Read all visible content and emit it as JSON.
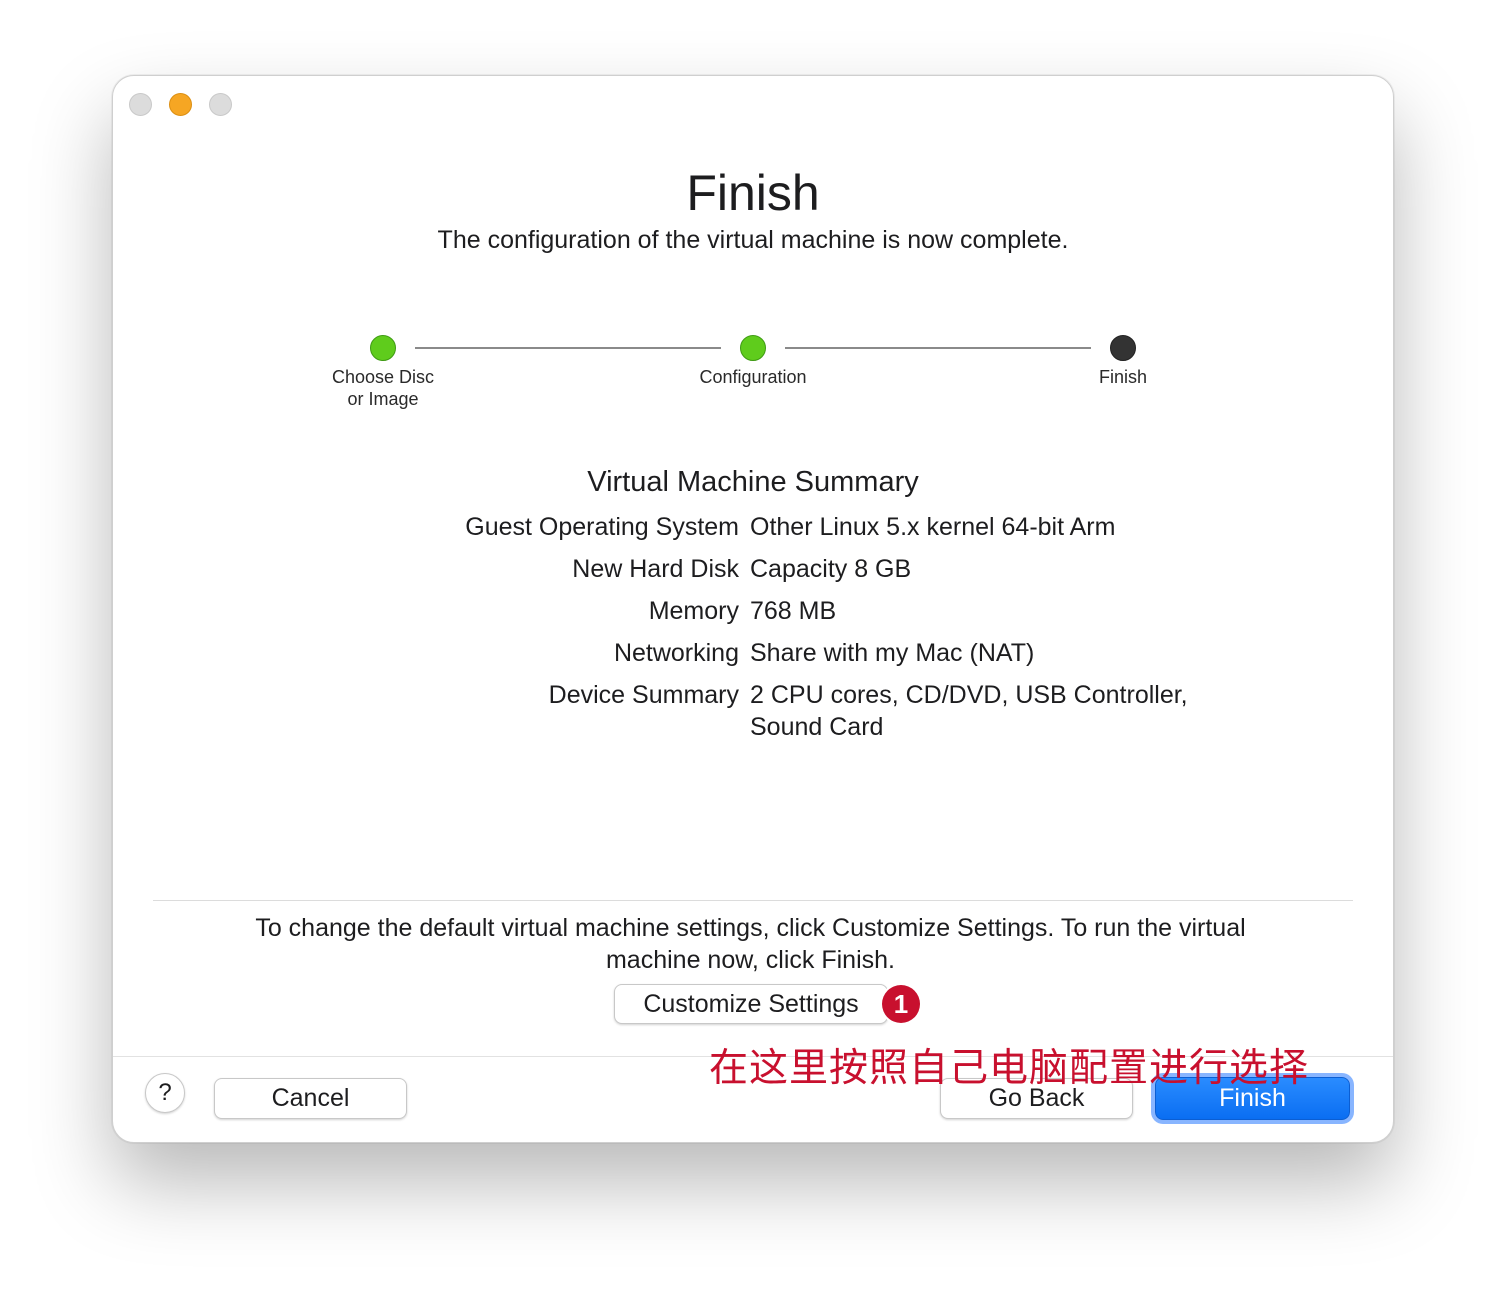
{
  "window": {
    "title": "Finish",
    "subtitle": "The configuration of the virtual machine is now complete."
  },
  "steps": [
    {
      "label": "Choose Disc\nor Image",
      "state": "done"
    },
    {
      "label": "Configuration",
      "state": "done"
    },
    {
      "label": "Finish",
      "state": "current"
    }
  ],
  "summary": {
    "heading": "Virtual Machine Summary",
    "rows": [
      {
        "key": "Guest Operating System",
        "value": "Other Linux 5.x kernel 64-bit Arm"
      },
      {
        "key": "New Hard Disk",
        "value": "Capacity 8 GB"
      },
      {
        "key": "Memory",
        "value": "768 MB"
      },
      {
        "key": "Networking",
        "value": "Share with my Mac (NAT)"
      },
      {
        "key": "Device Summary",
        "value": "2 CPU cores, CD/DVD, USB Controller, Sound Card"
      }
    ]
  },
  "info_text": "To change the default virtual machine settings, click Customize Settings. To run the virtual machine now, click Finish.",
  "buttons": {
    "customize": "Customize Settings",
    "help": "?",
    "cancel": "Cancel",
    "go_back": "Go Back",
    "finish": "Finish"
  },
  "annotation": {
    "badge": "1",
    "text": "在这里按照自己电脑配置进行选择"
  },
  "colors": {
    "step_done": "#5fcc1c",
    "step_current": "#333333",
    "primary_button": "#0a6ef2",
    "annotation": "#c8102e",
    "traffic_minimize": "#f6a623"
  },
  "icons": {
    "close": "close-icon",
    "minimize": "minimize-icon",
    "zoom": "zoom-icon",
    "help": "question-icon"
  }
}
